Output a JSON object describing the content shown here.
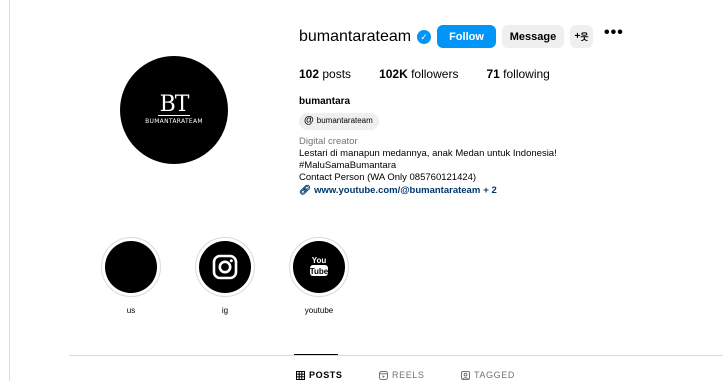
{
  "profile": {
    "username": "bumantarateam",
    "avatar_monogram": "BT",
    "avatar_brand_text": "BUMANTARATEAM",
    "verified": true,
    "stats": {
      "posts_count": "102",
      "posts_label": "posts",
      "followers_count": "102K",
      "followers_label": "followers",
      "following_count": "71",
      "following_label": "following"
    },
    "bio": {
      "name": "bumantara",
      "threads_handle": "bumantarateam",
      "category": "Digital creator",
      "line1": "Lestari di manapun medannya, anak Medan untuk Indonesia!",
      "line2": "#MaluSamaBumantara",
      "line3": "Contact Person (WA Only 085760121424)",
      "link": "www.youtube.com/@bumantarateam",
      "link_extra": "+ 2"
    }
  },
  "actions": {
    "follow_label": "Follow",
    "message_label": "Message",
    "add_user_icon": "add-user-icon",
    "more_icon": "more-options-icon"
  },
  "highlights": [
    {
      "label": "us",
      "icon": "none"
    },
    {
      "label": "ig",
      "icon": "instagram-icon"
    },
    {
      "label": "youtube",
      "icon": "youtube-icon"
    }
  ],
  "tabs": {
    "posts_label": "POSTS",
    "reels_label": "REELS",
    "tagged_label": "TAGGED",
    "active": "POSTS"
  },
  "colors": {
    "accent": "#0095f6",
    "link": "#00376b",
    "secondary_text": "#737373",
    "button_bg": "#efefef"
  }
}
